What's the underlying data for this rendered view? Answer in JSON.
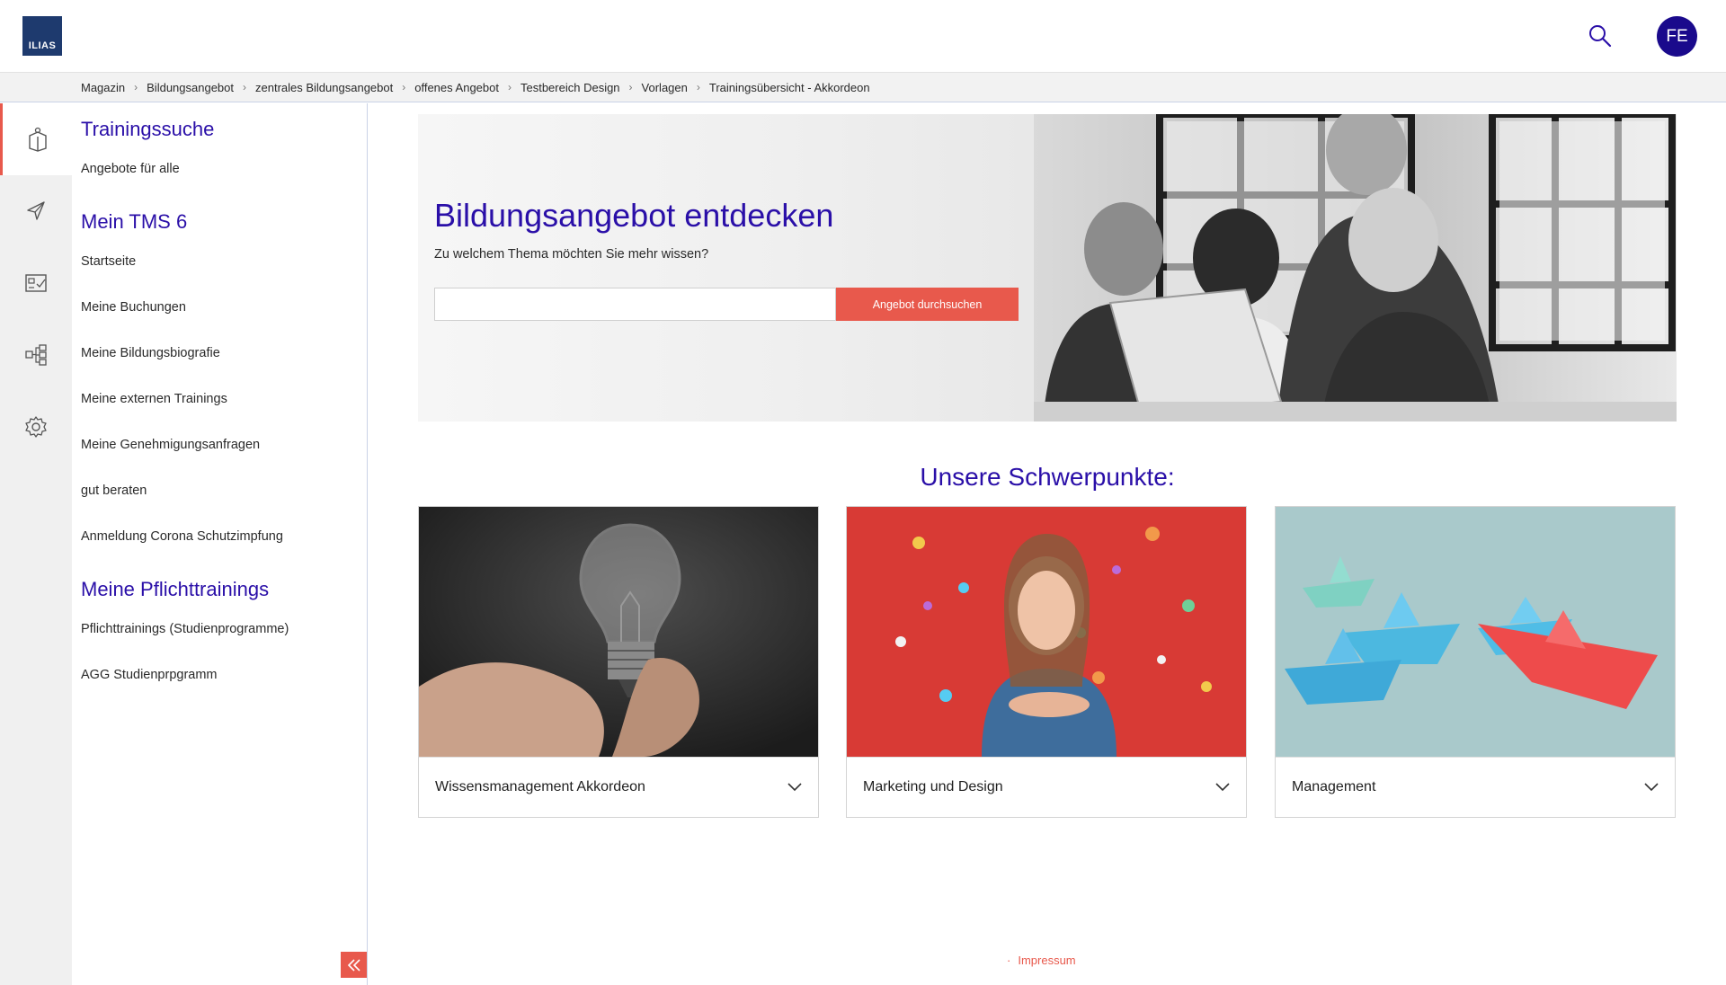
{
  "header": {
    "logo_text": "ILIAS",
    "avatar_initials": "FE",
    "avatar_color": "#1a0a8c"
  },
  "breadcrumb": [
    "Magazin",
    "Bildungsangebot",
    "zentrales Bildungsangebot",
    "offenes Angebot",
    "Testbereich Design",
    "Vorlagen",
    "Trainingsübersicht - Akkordeon"
  ],
  "rail": {
    "icons": [
      "book-icon",
      "send-icon",
      "checklist-icon",
      "hierarchy-icon",
      "gear-icon"
    ],
    "active_index": 0
  },
  "slate": {
    "sections": [
      {
        "heading": "Trainingssuche",
        "links": [
          "Angebote für alle"
        ]
      },
      {
        "heading": "Mein TMS 6",
        "links": [
          "Startseite",
          "Meine Buchungen",
          "Meine Bildungsbiografie",
          "Meine externen Trainings",
          "Meine Genehmigungsanfragen",
          "gut beraten",
          "Anmeldung Corona Schutzimpfung"
        ]
      },
      {
        "heading": "Meine Pflichttrainings",
        "links": [
          "Pflichttrainings (Studienprogramme)",
          "AGG Studienprpgramm"
        ]
      }
    ]
  },
  "hero": {
    "title": "Bildungsangebot entdecken",
    "subtitle": "Zu welchem Thema möchten Sie mehr wissen?",
    "search_value": "",
    "button_label": "Angebot durchsuchen"
  },
  "focus": {
    "title": "Unsere Schwerpunkte:",
    "cards": [
      {
        "label": "Wissensmanagement Akkordeon",
        "image": "lightbulb"
      },
      {
        "label": "Marketing und Design",
        "image": "confetti"
      },
      {
        "label": "Management",
        "image": "paper-boats"
      }
    ]
  },
  "footer": {
    "link": "Impressum"
  },
  "colors": {
    "accent": "#e8594c",
    "brand": "#2a0fa8"
  }
}
